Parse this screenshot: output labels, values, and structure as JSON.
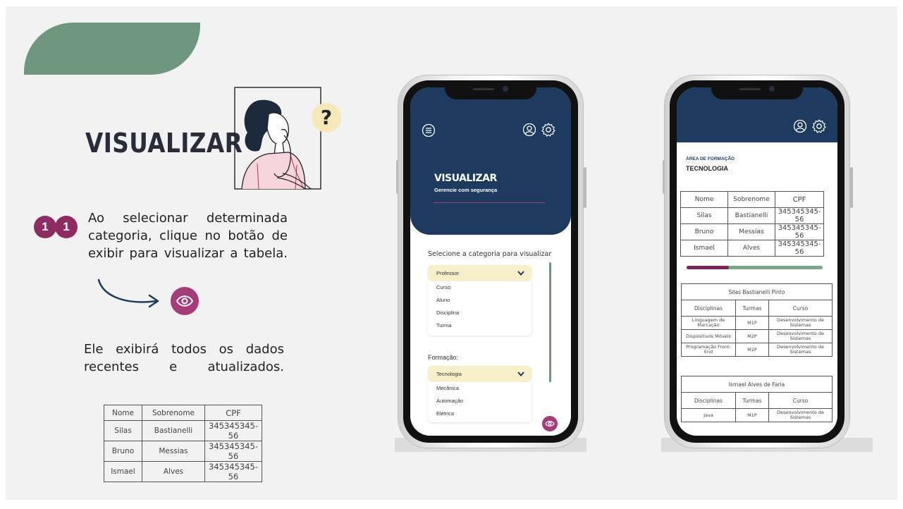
{
  "slide": {
    "title": "VISUALIZAR",
    "question_mark": "?",
    "step_digits": [
      "1",
      "1"
    ],
    "paragraph1": "Ao selecionar determinada categoria, clique no botão de exibir para visualizar a tabela.",
    "paragraph2": "Ele exibirá todos os dados recentes e atualizados.",
    "table": {
      "headers": [
        "Nome",
        "Sobrenome",
        "CPF"
      ],
      "rows": [
        [
          "Silas",
          "Bastianelli",
          "345345345-56"
        ],
        [
          "Bruno",
          "Messias",
          "345345345-56"
        ],
        [
          "Ismael",
          "Alves",
          "345345345-56"
        ]
      ]
    }
  },
  "phone1": {
    "title": "VISUALIZAR",
    "subtitle": "Gerencie com segurança",
    "select_label": "Selecione a categoria para visualizar",
    "category_selected": "Professor",
    "category_options": [
      "Curso",
      "Aluno",
      "Disciplina",
      "Turma"
    ],
    "formation_label": "Formação:",
    "formation_selected": "Tecnologia",
    "formation_options": [
      "Mecânica",
      "Automação",
      "Elétrica"
    ]
  },
  "phone2": {
    "area_label": "ÁREA DE FORMAÇÃO",
    "area_value": "TECNOLOGIA",
    "progress": 0.31,
    "table": {
      "headers": [
        "Nome",
        "Sobrenome",
        "CPF"
      ],
      "rows": [
        [
          "Silas",
          "Bastianelli",
          "345345345-56"
        ],
        [
          "Bruno",
          "Messias",
          "345345345-56"
        ],
        [
          "Ismael",
          "Alves",
          "345345345-56"
        ]
      ]
    },
    "card1": {
      "name": "Silas Bastianelli Pinto",
      "headers": [
        "Disciplinas",
        "Turmas",
        "Curso"
      ],
      "rows": [
        [
          "Linguagem de Marcação",
          "M1P",
          "Desenvolvimento de Sistemas"
        ],
        [
          "Dispositivos Móveis",
          "M2P",
          "Desenvolvimento de Sistemas"
        ],
        [
          "Programação Front-End",
          "M2P",
          "Desenvolvimento de Sistemas"
        ]
      ]
    },
    "card2": {
      "name": "Ismael Alves de Faria",
      "headers": [
        "Disciplinas",
        "Turmas",
        "Curso"
      ],
      "rows": [
        [
          "Java",
          "M1P",
          "Desenvolvimento de Sistemas"
        ]
      ]
    }
  },
  "colors": {
    "green": "#6f977f",
    "navy": "#1e3a5f",
    "magenta": "#a73c7a",
    "cream": "#f7efca",
    "progress_fill": "#7b2455"
  },
  "icons": [
    "menu-icon",
    "user-icon",
    "gear-icon",
    "chevron-down-icon",
    "eye-icon",
    "arrow-icon"
  ]
}
